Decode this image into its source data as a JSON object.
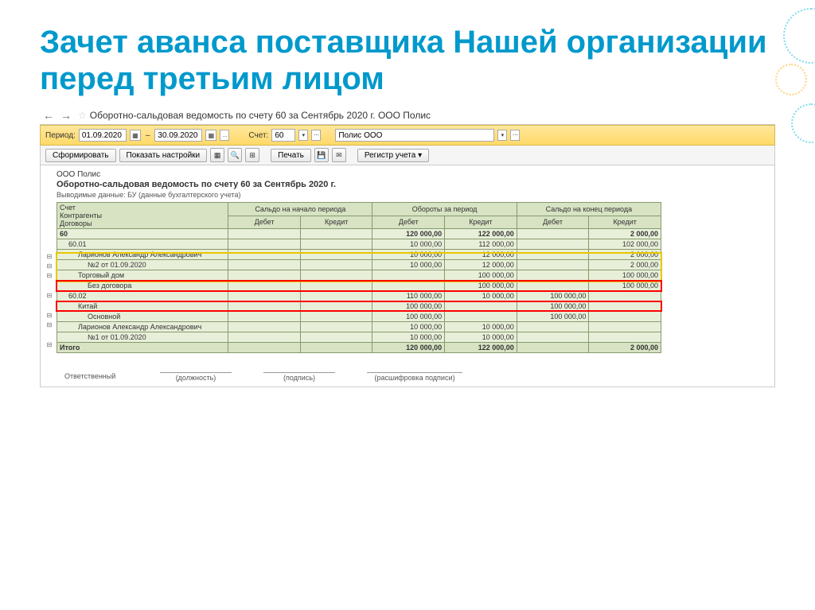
{
  "slide": {
    "title": "Зачет аванса поставщика Нашей организации перед третьим лицом"
  },
  "header": {
    "title": "Оборотно-сальдовая ведомость по счету 60 за Сентябрь 2020 г. ООО Полис"
  },
  "toolbar": {
    "period_label": "Период:",
    "date_from": "01.09.2020",
    "date_to": "30.09.2020",
    "dots": "...",
    "account_label": "Счет:",
    "account": "60",
    "org": "Полис ООО"
  },
  "toolbar2": {
    "form": "Сформировать",
    "settings": "Показать настройки",
    "print": "Печать",
    "register": "Регистр учета"
  },
  "report": {
    "org": "ООО Полис",
    "title": "Оборотно-сальдовая ведомость по счету 60 за Сентябрь 2020 г.",
    "sub": "Выводимые данные: БУ (данные бухгалтерского учета)"
  },
  "cols": {
    "c1a": "Счет",
    "c1b": "Контрагенты",
    "c1c": "Договоры",
    "g1": "Сальдо на начало периода",
    "g2": "Обороты за период",
    "g3": "Сальдо на конец периода",
    "d": "Дебет",
    "k": "Кредит"
  },
  "rows": [
    {
      "lvl": 0,
      "name": "60",
      "d1": "",
      "k1": "",
      "d2": "120 000,00",
      "k2": "122 000,00",
      "d3": "",
      "k3": "2 000,00",
      "bold": true
    },
    {
      "lvl": 1,
      "name": "60.01",
      "d1": "",
      "k1": "",
      "d2": "10 000,00",
      "k2": "112 000,00",
      "d3": "",
      "k3": "102 000,00"
    },
    {
      "lvl": 2,
      "name": "Ларионов Александр Александрович",
      "d1": "",
      "k1": "",
      "d2": "10 000,00",
      "k2": "12 000,00",
      "d3": "",
      "k3": "2 000,00"
    },
    {
      "lvl": 3,
      "name": "№2 от 01.09.2020",
      "d1": "",
      "k1": "",
      "d2": "10 000,00",
      "k2": "12 000,00",
      "d3": "",
      "k3": "2 000,00"
    },
    {
      "lvl": 2,
      "name": "Торговый дом",
      "d1": "",
      "k1": "",
      "d2": "",
      "k2": "100 000,00",
      "d3": "",
      "k3": "100 000,00"
    },
    {
      "lvl": 3,
      "name": "Без договора",
      "d1": "",
      "k1": "",
      "d2": "",
      "k2": "100 000,00",
      "d3": "",
      "k3": "100 000,00"
    },
    {
      "lvl": 1,
      "name": "60.02",
      "d1": "",
      "k1": "",
      "d2": "110 000,00",
      "k2": "10 000,00",
      "d3": "100 000,00",
      "k3": ""
    },
    {
      "lvl": 2,
      "name": "Китай",
      "d1": "",
      "k1": "",
      "d2": "100 000,00",
      "k2": "",
      "d3": "100 000,00",
      "k3": ""
    },
    {
      "lvl": 3,
      "name": "Основной",
      "d1": "",
      "k1": "",
      "d2": "100 000,00",
      "k2": "",
      "d3": "100 000,00",
      "k3": ""
    },
    {
      "lvl": 2,
      "name": "Ларионов Александр Александрович",
      "d1": "",
      "k1": "",
      "d2": "10 000,00",
      "k2": "10 000,00",
      "d3": "",
      "k3": ""
    },
    {
      "lvl": 3,
      "name": "№1 от 01.09.2020",
      "d1": "",
      "k1": "",
      "d2": "10 000,00",
      "k2": "10 000,00",
      "d3": "",
      "k3": ""
    }
  ],
  "total": {
    "name": "Итого",
    "d1": "",
    "k1": "",
    "d2": "120 000,00",
    "k2": "122 000,00",
    "d3": "",
    "k3": "2 000,00"
  },
  "footer": {
    "resp": "Ответственный",
    "pos": "(должность)",
    "sig": "(подпись)",
    "dec": "(расшифровка подписи)"
  }
}
